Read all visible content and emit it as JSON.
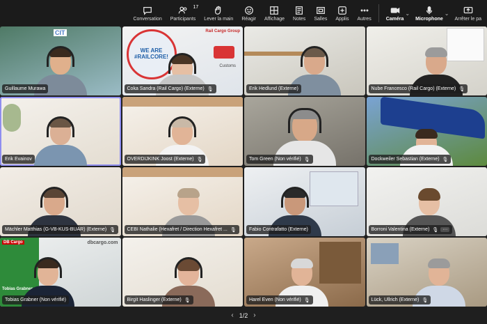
{
  "toolbar": {
    "conversation": "Conversation",
    "participants": "Participants",
    "participants_count": "17",
    "raise_hand": "Lever la main",
    "react": "Réagir",
    "view": "Affichage",
    "notes": "Notes",
    "rooms": "Salles",
    "apps": "Applis",
    "more": "Autres",
    "camera": "Caméra",
    "microphone": "Microphone",
    "leave": "Arrêter le pa"
  },
  "tiles": [
    {
      "name": "Guillaume Murawa",
      "mic": false,
      "logo": "CIT"
    },
    {
      "name": "Coka Sandra (Rail Cargo) (Externe)",
      "mic": true,
      "logo": "Rail Cargo Group",
      "banner": "WE ARE #RAILCORE!",
      "banner_sub": "Customs"
    },
    {
      "name": "Erik Hedlund (Externe)",
      "mic": false
    },
    {
      "name": "Nube Francesco (Rail Cargo) (Externe)",
      "mic": true
    },
    {
      "name": "Erik Evainov",
      "mic": false
    },
    {
      "name": "OVERDIJKINK Joost (Externe)",
      "mic": true
    },
    {
      "name": "Tom Green (Non vérifié)",
      "mic": true
    },
    {
      "name": "Dockweiler Sebastian (Externe)",
      "mic": true
    },
    {
      "name": "Mächler Matthias (G-VB-KUS-BUAR) (Externe)",
      "mic": true
    },
    {
      "name": "CEBI Nathalie (Hexafret / Direction Hexafret ...",
      "mic": true
    },
    {
      "name": "Fabio Contrafatto (Externe)",
      "mic": false
    },
    {
      "name": "Borroni Valentina (Externe)",
      "mic": true,
      "more": "···"
    },
    {
      "name": "Tobias Grabner (Non vérifié)",
      "mic": false,
      "logo": "dbcargo.com",
      "logo2": "DB Cargo",
      "overlay_name": "Tobias Grabner"
    },
    {
      "name": "Birgit Haslinger (Externe)",
      "mic": true
    },
    {
      "name": "Harel Even (Non vérifié)",
      "mic": true
    },
    {
      "name": "Lück, Ullrich (Externe)",
      "mic": true
    }
  ],
  "pager": {
    "label": "1/2",
    "prev": "‹",
    "next": "›"
  },
  "colors": {
    "accent": "#8f8ef0",
    "toolbar_bg": "#1b1b1b",
    "page_bg": "#1f1f1f"
  }
}
